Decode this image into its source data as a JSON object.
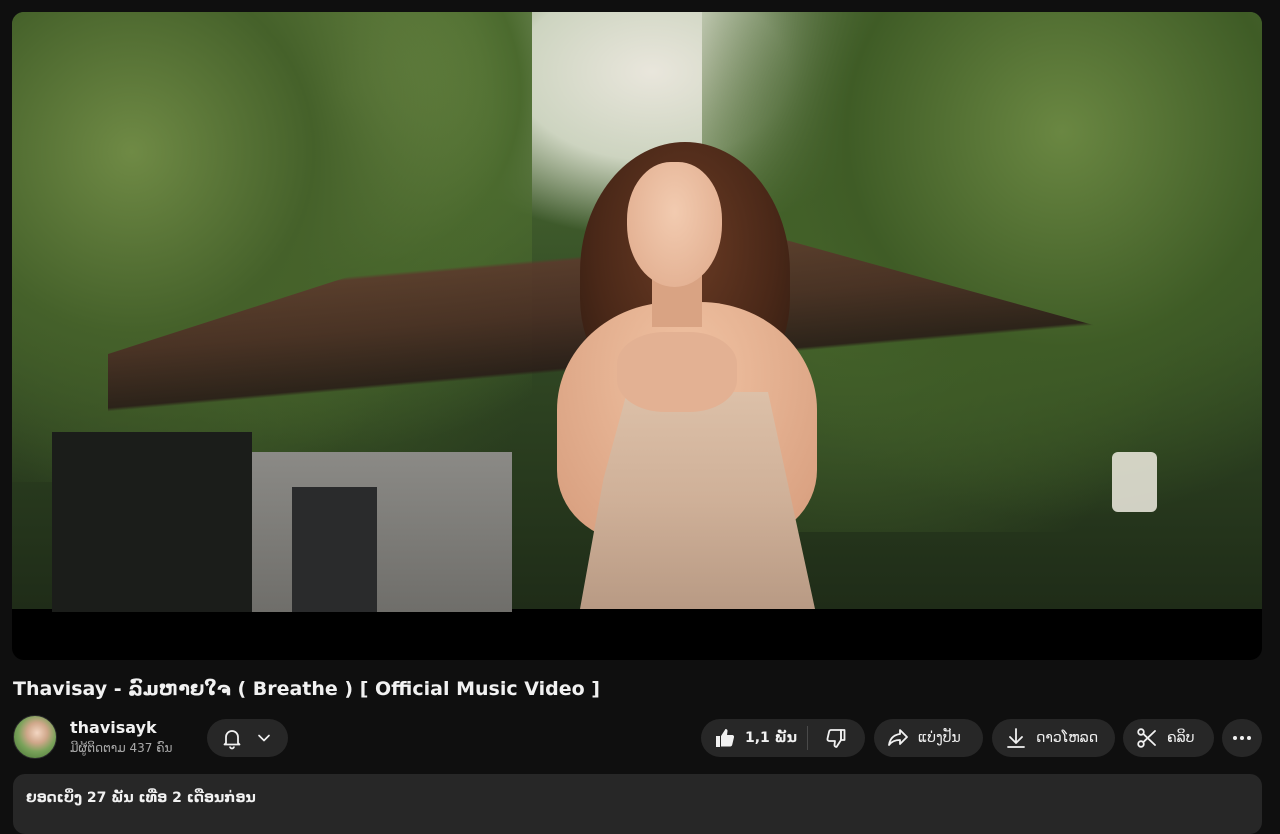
{
  "video": {
    "title": "Thavisay - ລົມຫາຍໃຈ ( Breathe ) [ Official Music Video ]"
  },
  "channel": {
    "name": "thavisayk",
    "subscribers": "ມີຜູ້ຕິດຕາມ 437 ຄົນ"
  },
  "actions": {
    "like_count": "1,1 ພັນ",
    "share_label": "ແບ່ງປັນ",
    "download_label": "ດາວໂຫລດ",
    "clip_label": "ຄລິບ"
  },
  "description": {
    "meta": "ຍອດເບິ່ງ 27 ພັນ ເທື່ອ  2 ເດືອນກ່ອນ"
  },
  "icons": {
    "bell": "bell-icon",
    "chevron": "chevron-down-icon",
    "like": "thumbs-up-icon",
    "dislike": "thumbs-down-icon",
    "share": "share-arrow-icon",
    "download": "download-icon",
    "clip": "scissors-icon",
    "more": "more-horizontal-icon"
  },
  "colors": {
    "background": "#0f0f0f",
    "pill": "#272727",
    "text": "#f1f1f1",
    "secondary_text": "#aaaaaa"
  }
}
